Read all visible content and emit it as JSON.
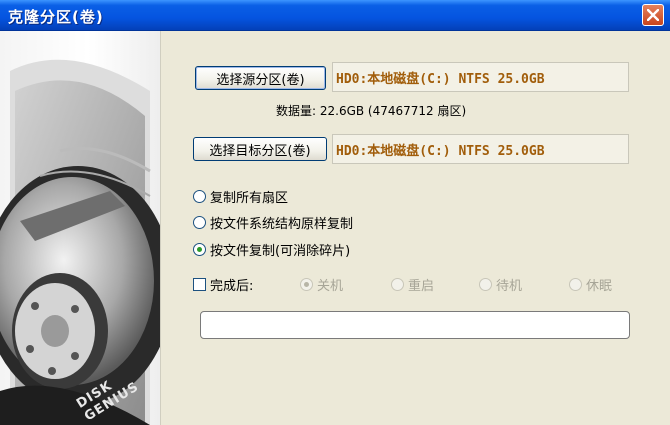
{
  "window": {
    "title": "克隆分区(卷)"
  },
  "branding": {
    "logo_text": "DISK GENIUS"
  },
  "source": {
    "button_label": "选择源分区(卷)",
    "partition_text": "HD0:本地磁盘(C:) NTFS 25.0GB"
  },
  "data_info": "数据量: 22.6GB (47467712 扇区)",
  "target": {
    "button_label": "选择目标分区(卷)",
    "partition_text": "HD0:本地磁盘(C:) NTFS 25.0GB"
  },
  "copy_modes": {
    "selected": 2,
    "options": [
      {
        "label": "复制所有扇区"
      },
      {
        "label": "按文件系统结构原样复制"
      },
      {
        "label": "按文件复制(可消除碎片)"
      }
    ]
  },
  "after_completion": {
    "checkbox_label": "完成后:",
    "checked": false,
    "selected": 0,
    "options": [
      {
        "label": "关机"
      },
      {
        "label": "重启"
      },
      {
        "label": "待机"
      },
      {
        "label": "休眠"
      }
    ]
  },
  "progress": {
    "value": 0
  },
  "colors": {
    "partition_text": "#a15d0a",
    "titlebar": "#0554e0",
    "dialog_bg": "#ece9d8"
  }
}
